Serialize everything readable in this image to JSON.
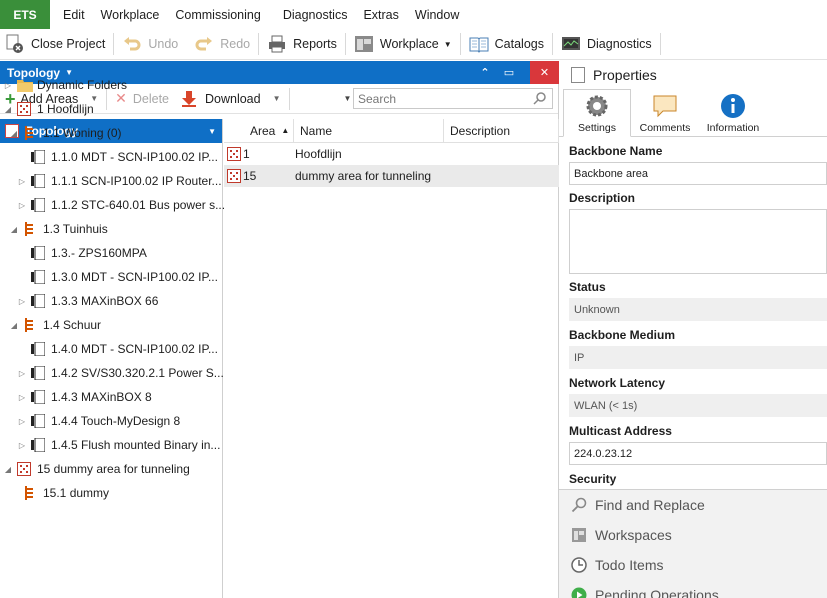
{
  "menubar": {
    "app_button": "ETS",
    "items": [
      "Edit",
      "Workplace",
      "Commissioning",
      "Diagnostics",
      "Extras",
      "Window"
    ]
  },
  "toolbar": {
    "close_project": "Close Project",
    "undo": "Undo",
    "redo": "Redo",
    "reports": "Reports",
    "workplace": "Workplace",
    "catalogs": "Catalogs",
    "diagnostics": "Diagnostics"
  },
  "pane": {
    "title": "Topology",
    "add_areas": "Add Areas",
    "delete": "Delete",
    "download": "Download",
    "search_placeholder": "Search"
  },
  "tree": {
    "header": "Topology",
    "rows": [
      {
        "label": "Dynamic Folders",
        "icon": "folder-icon"
      },
      {
        "label": "1 Hoofdlijn",
        "icon": "area-icon"
      },
      {
        "label": "1.1 Woning (0)",
        "icon": "line-icon"
      },
      {
        "label": "1.1.0 MDT - SCN-IP100.02 IP...",
        "icon": "device-icon"
      },
      {
        "label": "1.1.1 SCN-IP100.02 IP Router...",
        "icon": "device-icon"
      },
      {
        "label": "1.1.2 STC-640.01 Bus power s...",
        "icon": "device-icon"
      },
      {
        "label": "1.3 Tuinhuis",
        "icon": "line-icon"
      },
      {
        "label": "1.3.- ZPS160MPA",
        "icon": "device-icon"
      },
      {
        "label": "1.3.0 MDT - SCN-IP100.02 IP...",
        "icon": "device-icon"
      },
      {
        "label": "1.3.3 MAXinBOX 66",
        "icon": "device-icon"
      },
      {
        "label": "1.4 Schuur",
        "icon": "line-icon"
      },
      {
        "label": "1.4.0 MDT - SCN-IP100.02 IP...",
        "icon": "device-icon"
      },
      {
        "label": "1.4.2 SV/S30.320.2.1 Power S...",
        "icon": "device-icon"
      },
      {
        "label": "1.4.3 MAXinBOX 8",
        "icon": "device-icon"
      },
      {
        "label": "1.4.4 Touch-MyDesign 8",
        "icon": "device-icon"
      },
      {
        "label": "1.4.5 Flush mounted Binary in...",
        "icon": "device-icon"
      },
      {
        "label": "15 dummy area for tunneling",
        "icon": "area-icon"
      },
      {
        "label": "15.1 dummy",
        "icon": "line-icon"
      }
    ]
  },
  "table": {
    "columns": [
      "Area",
      "Name",
      "Description"
    ],
    "rows": [
      {
        "area": "1",
        "name": "Hoofdlijn",
        "description": ""
      },
      {
        "area": "15",
        "name": "dummy area for tunneling",
        "description": ""
      }
    ]
  },
  "properties": {
    "title": "Properties",
    "tabs": [
      "Settings",
      "Comments",
      "Information"
    ],
    "backbone_name_label": "Backbone Name",
    "backbone_name_value": "Backbone area",
    "description_label": "Description",
    "status_label": "Status",
    "status_value": "Unknown",
    "medium_label": "Backbone Medium",
    "medium_value": "IP",
    "latency_label": "Network Latency",
    "latency_value": "WLAN (< 1s)",
    "multicast_label": "Multicast Address",
    "multicast_value": "224.0.23.12",
    "security_label": "Security"
  },
  "side_panels": [
    "Find and Replace",
    "Workspaces",
    "Todo Items",
    "Pending Operations"
  ],
  "colors": {
    "accent": "#0f6fc6",
    "ets_green": "#3a8f3a",
    "close_red": "#d9373b"
  }
}
